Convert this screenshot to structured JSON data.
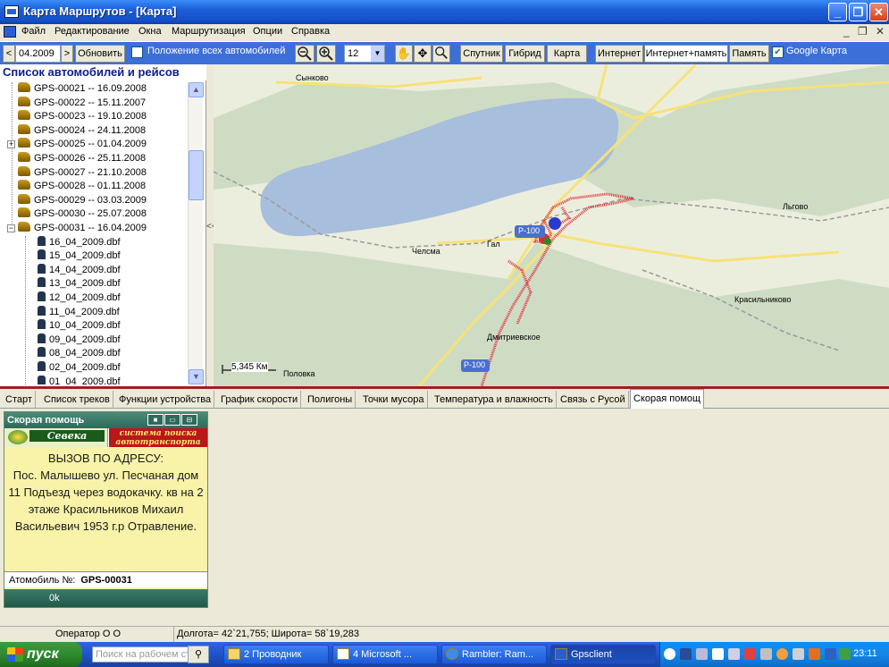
{
  "window": {
    "title": "Карта Маршрутов - [Карта]",
    "min": "_",
    "max": "❐",
    "close": "✕"
  },
  "menu": [
    "Файл",
    "Редактирование",
    "Окна",
    "Маршрутизация",
    "Опции",
    "Справка"
  ],
  "mdi": {
    "min": "_",
    "restore": "❐",
    "close": "✕"
  },
  "toolbar": {
    "prev": "<",
    "date": "04.2009",
    "next": ">",
    "refresh": "Обновить",
    "all_cars": "Положение всех автомобилей",
    "zoom_level": "12",
    "satellite": "Спутник",
    "hybrid": "Гибрид",
    "map": "Карта",
    "internet": "Интернет",
    "internet_memory": "Интернет+память",
    "memory": "Память",
    "google": "Google Карта",
    "google_checked": "✔"
  },
  "left": {
    "header": "Список автомобилей и рейсов",
    "vehicles": [
      "GPS-00021 -- 16.09.2008",
      "GPS-00022 -- 15.11.2007",
      "GPS-00023 -- 19.10.2008",
      "GPS-00024 -- 24.11.2008",
      "GPS-00025 -- 01.04.2009",
      "GPS-00026 -- 25.11.2008",
      "GPS-00027 -- 21.10.2008",
      "GPS-00028 -- 01.11.2008",
      "GPS-00029 -- 03.03.2009",
      "GPS-00030 -- 25.07.2008",
      "GPS-00031 -- 16.04.2009"
    ],
    "files": [
      "16_04_2009.dbf",
      "15_04_2009.dbf",
      "14_04_2009.dbf",
      "13_04_2009.dbf",
      "12_04_2009.dbf",
      "11_04_2009.dbf",
      "10_04_2009.dbf",
      "09_04_2009.dbf",
      "08_04_2009.dbf",
      "02_04_2009.dbf",
      "01_04_2009.dbf"
    ],
    "splitter": "<<"
  },
  "map": {
    "labels": [
      "Сынково",
      "Челсма",
      "Гал",
      "Льгово",
      "Красильниково",
      "Дмитриевское",
      "Половка"
    ],
    "road_labels": [
      "P-100",
      "P-100"
    ],
    "scale": "5,345 Км",
    "colors": {
      "lake": "#a7bedc",
      "forest": "#cfdcc4",
      "land": "#eceedd",
      "road": "#f6e27a",
      "track": "#e0303a"
    }
  },
  "tabs": [
    "Старт",
    "Список треков",
    "Функции устройства",
    "График скорости",
    "Полигоны",
    "Точки мусора",
    "Температура и влажность",
    "Связь с Русой",
    "Скорая помощ"
  ],
  "ambulance": {
    "header": "Скорая помощь",
    "icons": [
      "disk-icon",
      "battery-icon",
      "bus-icon"
    ],
    "logo_name": "Севека",
    "logo_tagline": "система поиска автотранспорта",
    "title": "ВЫЗОВ ПО АДРЕСУ:",
    "message": "Пос. Малышево ул. Песчаная дом 11 Подъезд через водокачку. кв на 2 этаже Красильников Михаил Васильевич 1953 г.р Отравление.",
    "car_label": "Атомобиль №:",
    "car_value": "GPS-00031",
    "ok": "0k"
  },
  "status": {
    "operator": "Оператор О О",
    "coords": "Долгота= 42`21,755; Широта= 58`19,283"
  },
  "taskbar": {
    "start": "пуск",
    "search_placeholder": "Поиск на рабочем ст",
    "tasks": [
      "2 Проводник",
      "4 Microsoft ...",
      "Rambler: Ram...",
      "Gpsclient"
    ],
    "clock": "23:11"
  }
}
